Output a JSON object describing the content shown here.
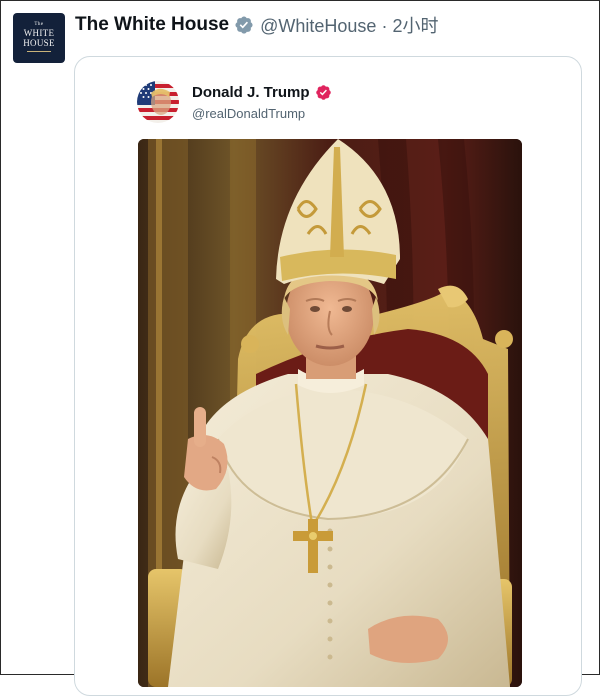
{
  "post": {
    "author_avatar_lines": [
      "The",
      "WHITE",
      "HOUSE"
    ],
    "display_name": "The White House",
    "handle": "@WhiteHouse",
    "separator": "·",
    "time": "2小时"
  },
  "quoted_post": {
    "display_name": "Donald J. Trump",
    "handle": "@realDonaldTrump",
    "media_alt": "Portrait of a man in papal vestments seated on a gilded throne, raising his right index finger"
  },
  "colors": {
    "verified_gray": "#829aab",
    "verified_pink": "#e0245e",
    "text_primary": "#0f1419",
    "text_secondary": "#536471",
    "border": "#cfd9de"
  },
  "icons": {
    "verified_gray": "verified-badge-gray-icon",
    "verified_pink": "verified-badge-pink-icon"
  }
}
